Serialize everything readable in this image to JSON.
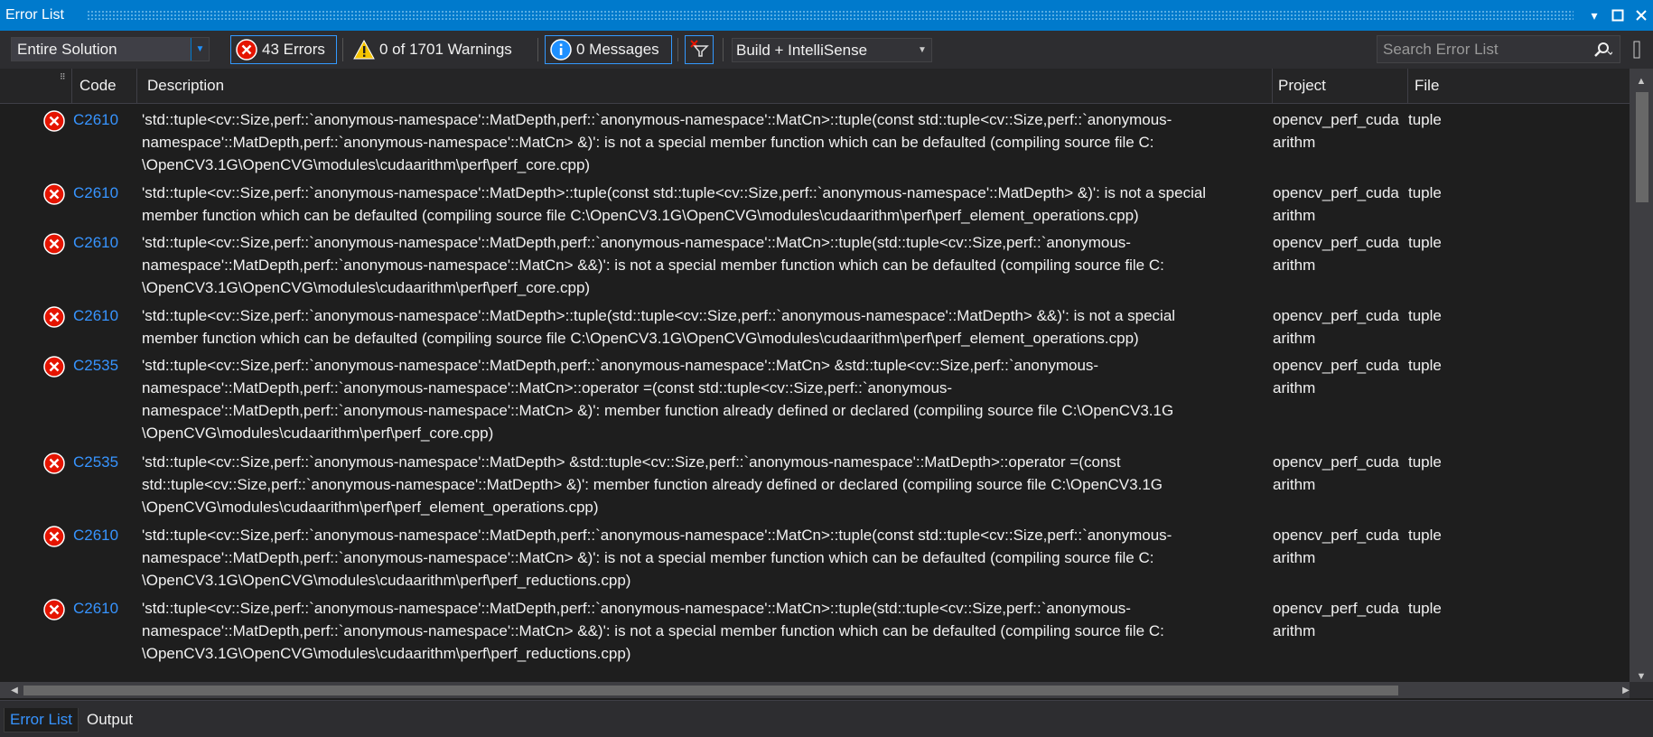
{
  "window": {
    "title": "Error List"
  },
  "toolbar": {
    "scope": "Entire Solution",
    "errors_label": "43 Errors",
    "warnings_label": "0 of 1701 Warnings",
    "messages_label": "0 Messages",
    "build_filter": "Build + IntelliSense",
    "search_placeholder": "Search Error List"
  },
  "columns": {
    "code": "Code",
    "description": "Description",
    "project": "Project",
    "file": "File"
  },
  "rows": [
    {
      "code": "C2610",
      "lines": [
        "'std::tuple<cv::Size,perf::`anonymous-namespace'::MatDepth,perf::`anonymous-namespace'::MatCn>::tuple(const std::tuple<cv::Size,perf::`anonymous-",
        "namespace'::MatDepth,perf::`anonymous-namespace'::MatCn> &)': is not a special member function which can be defaulted (compiling source file C:",
        "\\OpenCV3.1G\\OpenCVG\\modules\\cudaarithm\\perf\\perf_core.cpp)"
      ],
      "project_lines": [
        "opencv_perf_cuda",
        "arithm"
      ],
      "file": "tuple"
    },
    {
      "code": "C2610",
      "lines": [
        "'std::tuple<cv::Size,perf::`anonymous-namespace'::MatDepth>::tuple(const std::tuple<cv::Size,perf::`anonymous-namespace'::MatDepth> &)': is not a special",
        "member function which can be defaulted (compiling source file C:\\OpenCV3.1G\\OpenCVG\\modules\\cudaarithm\\perf\\perf_element_operations.cpp)"
      ],
      "project_lines": [
        "opencv_perf_cuda",
        "arithm"
      ],
      "file": "tuple"
    },
    {
      "code": "C2610",
      "lines": [
        "'std::tuple<cv::Size,perf::`anonymous-namespace'::MatDepth,perf::`anonymous-namespace'::MatCn>::tuple(std::tuple<cv::Size,perf::`anonymous-",
        "namespace'::MatDepth,perf::`anonymous-namespace'::MatCn> &&)': is not a special member function which can be defaulted (compiling source file C:",
        "\\OpenCV3.1G\\OpenCVG\\modules\\cudaarithm\\perf\\perf_core.cpp)"
      ],
      "project_lines": [
        "opencv_perf_cuda",
        "arithm"
      ],
      "file": "tuple"
    },
    {
      "code": "C2610",
      "lines": [
        "'std::tuple<cv::Size,perf::`anonymous-namespace'::MatDepth>::tuple(std::tuple<cv::Size,perf::`anonymous-namespace'::MatDepth> &&)': is not a special",
        "member function which can be defaulted (compiling source file C:\\OpenCV3.1G\\OpenCVG\\modules\\cudaarithm\\perf\\perf_element_operations.cpp)"
      ],
      "project_lines": [
        "opencv_perf_cuda",
        "arithm"
      ],
      "file": "tuple"
    },
    {
      "code": "C2535",
      "lines": [
        "'std::tuple<cv::Size,perf::`anonymous-namespace'::MatDepth,perf::`anonymous-namespace'::MatCn> &std::tuple<cv::Size,perf::`anonymous-",
        "namespace'::MatDepth,perf::`anonymous-namespace'::MatCn>::operator =(const std::tuple<cv::Size,perf::`anonymous-",
        "namespace'::MatDepth,perf::`anonymous-namespace'::MatCn> &)': member function already defined or declared (compiling source file C:\\OpenCV3.1G",
        "\\OpenCVG\\modules\\cudaarithm\\perf\\perf_core.cpp)"
      ],
      "project_lines": [
        "opencv_perf_cuda",
        "arithm"
      ],
      "file": "tuple"
    },
    {
      "code": "C2535",
      "lines": [
        "'std::tuple<cv::Size,perf::`anonymous-namespace'::MatDepth> &std::tuple<cv::Size,perf::`anonymous-namespace'::MatDepth>::operator =(const",
        "std::tuple<cv::Size,perf::`anonymous-namespace'::MatDepth> &)': member function already defined or declared (compiling source file C:\\OpenCV3.1G",
        "\\OpenCVG\\modules\\cudaarithm\\perf\\perf_element_operations.cpp)"
      ],
      "project_lines": [
        "opencv_perf_cuda",
        "arithm"
      ],
      "file": "tuple"
    },
    {
      "code": "C2610",
      "lines": [
        "'std::tuple<cv::Size,perf::`anonymous-namespace'::MatDepth,perf::`anonymous-namespace'::MatCn>::tuple(const std::tuple<cv::Size,perf::`anonymous-",
        "namespace'::MatDepth,perf::`anonymous-namespace'::MatCn> &)': is not a special member function which can be defaulted (compiling source file C:",
        "\\OpenCV3.1G\\OpenCVG\\modules\\cudaarithm\\perf\\perf_reductions.cpp)"
      ],
      "project_lines": [
        "opencv_perf_cuda",
        "arithm"
      ],
      "file": "tuple"
    },
    {
      "code": "C2610",
      "lines": [
        "'std::tuple<cv::Size,perf::`anonymous-namespace'::MatDepth,perf::`anonymous-namespace'::MatCn>::tuple(std::tuple<cv::Size,perf::`anonymous-",
        "namespace'::MatDepth,perf::`anonymous-namespace'::MatCn> &&)': is not a special member function which can be defaulted (compiling source file C:",
        "\\OpenCV3.1G\\OpenCVG\\modules\\cudaarithm\\perf\\perf_reductions.cpp)"
      ],
      "project_lines": [
        "opencv_perf_cuda",
        "arithm"
      ],
      "file": "tuple"
    }
  ],
  "bottom_tabs": [
    {
      "label": "Error List"
    },
    {
      "label": "Output"
    }
  ],
  "colors": {
    "accent": "#007acc",
    "error": "#e51400",
    "link": "#3794ff",
    "background": "#1e1e1e"
  }
}
